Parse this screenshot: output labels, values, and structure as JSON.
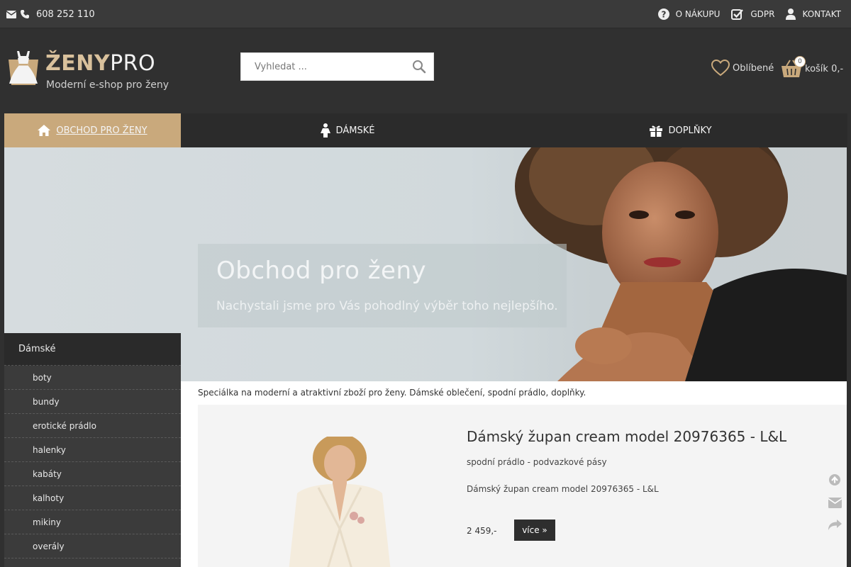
{
  "topbar": {
    "phone": "608 252 110",
    "links": [
      {
        "label": "O NÁKUPU",
        "icon": "question-circle-icon"
      },
      {
        "label": "GDPR",
        "icon": "check-square-icon"
      },
      {
        "label": "KONTAKT",
        "icon": "user-icon"
      }
    ]
  },
  "header": {
    "logo_brand_bold": "ŽENY",
    "logo_brand_rest": "PRO",
    "logo_tagline": "Moderní e-shop pro ženy",
    "search_placeholder": "Vyhledat ...",
    "favorites_label": "Oblíbené",
    "cart_label": "košík 0,-",
    "cart_count": "0"
  },
  "nav": {
    "items": [
      {
        "label": "OBCHOD PRO ŽENY",
        "icon": "home-icon",
        "active": true
      },
      {
        "label": "DÁMSKÉ",
        "icon": "woman-icon"
      },
      {
        "label": "DOPLŇKY",
        "icon": "gift-icon"
      }
    ]
  },
  "banner": {
    "title": "Obchod pro ženy",
    "subtitle": "Nachystali jsme pro Vás pohodlný výběr toho nejlepšího."
  },
  "sidebar": {
    "heading": "Dámské",
    "items": [
      "boty",
      "bundy",
      "erotické prádlo",
      "halenky",
      "kabáty",
      "kalhoty",
      "mikiny",
      "overály"
    ]
  },
  "content": {
    "intro": "Speciálka na moderní a atraktivní zboží pro ženy. Dámské oblečení, spodní prádlo, doplňky.",
    "product": {
      "title": "Dámský župan cream model 20976365 - L&L",
      "category": "spodní prádlo - podvazkové pásy",
      "description": "Dámský župan cream model 20976365 - L&L",
      "price": "2 459,-",
      "more_label": "více »"
    }
  },
  "colors": {
    "accent": "#c9a97c",
    "dark": "#303030"
  }
}
